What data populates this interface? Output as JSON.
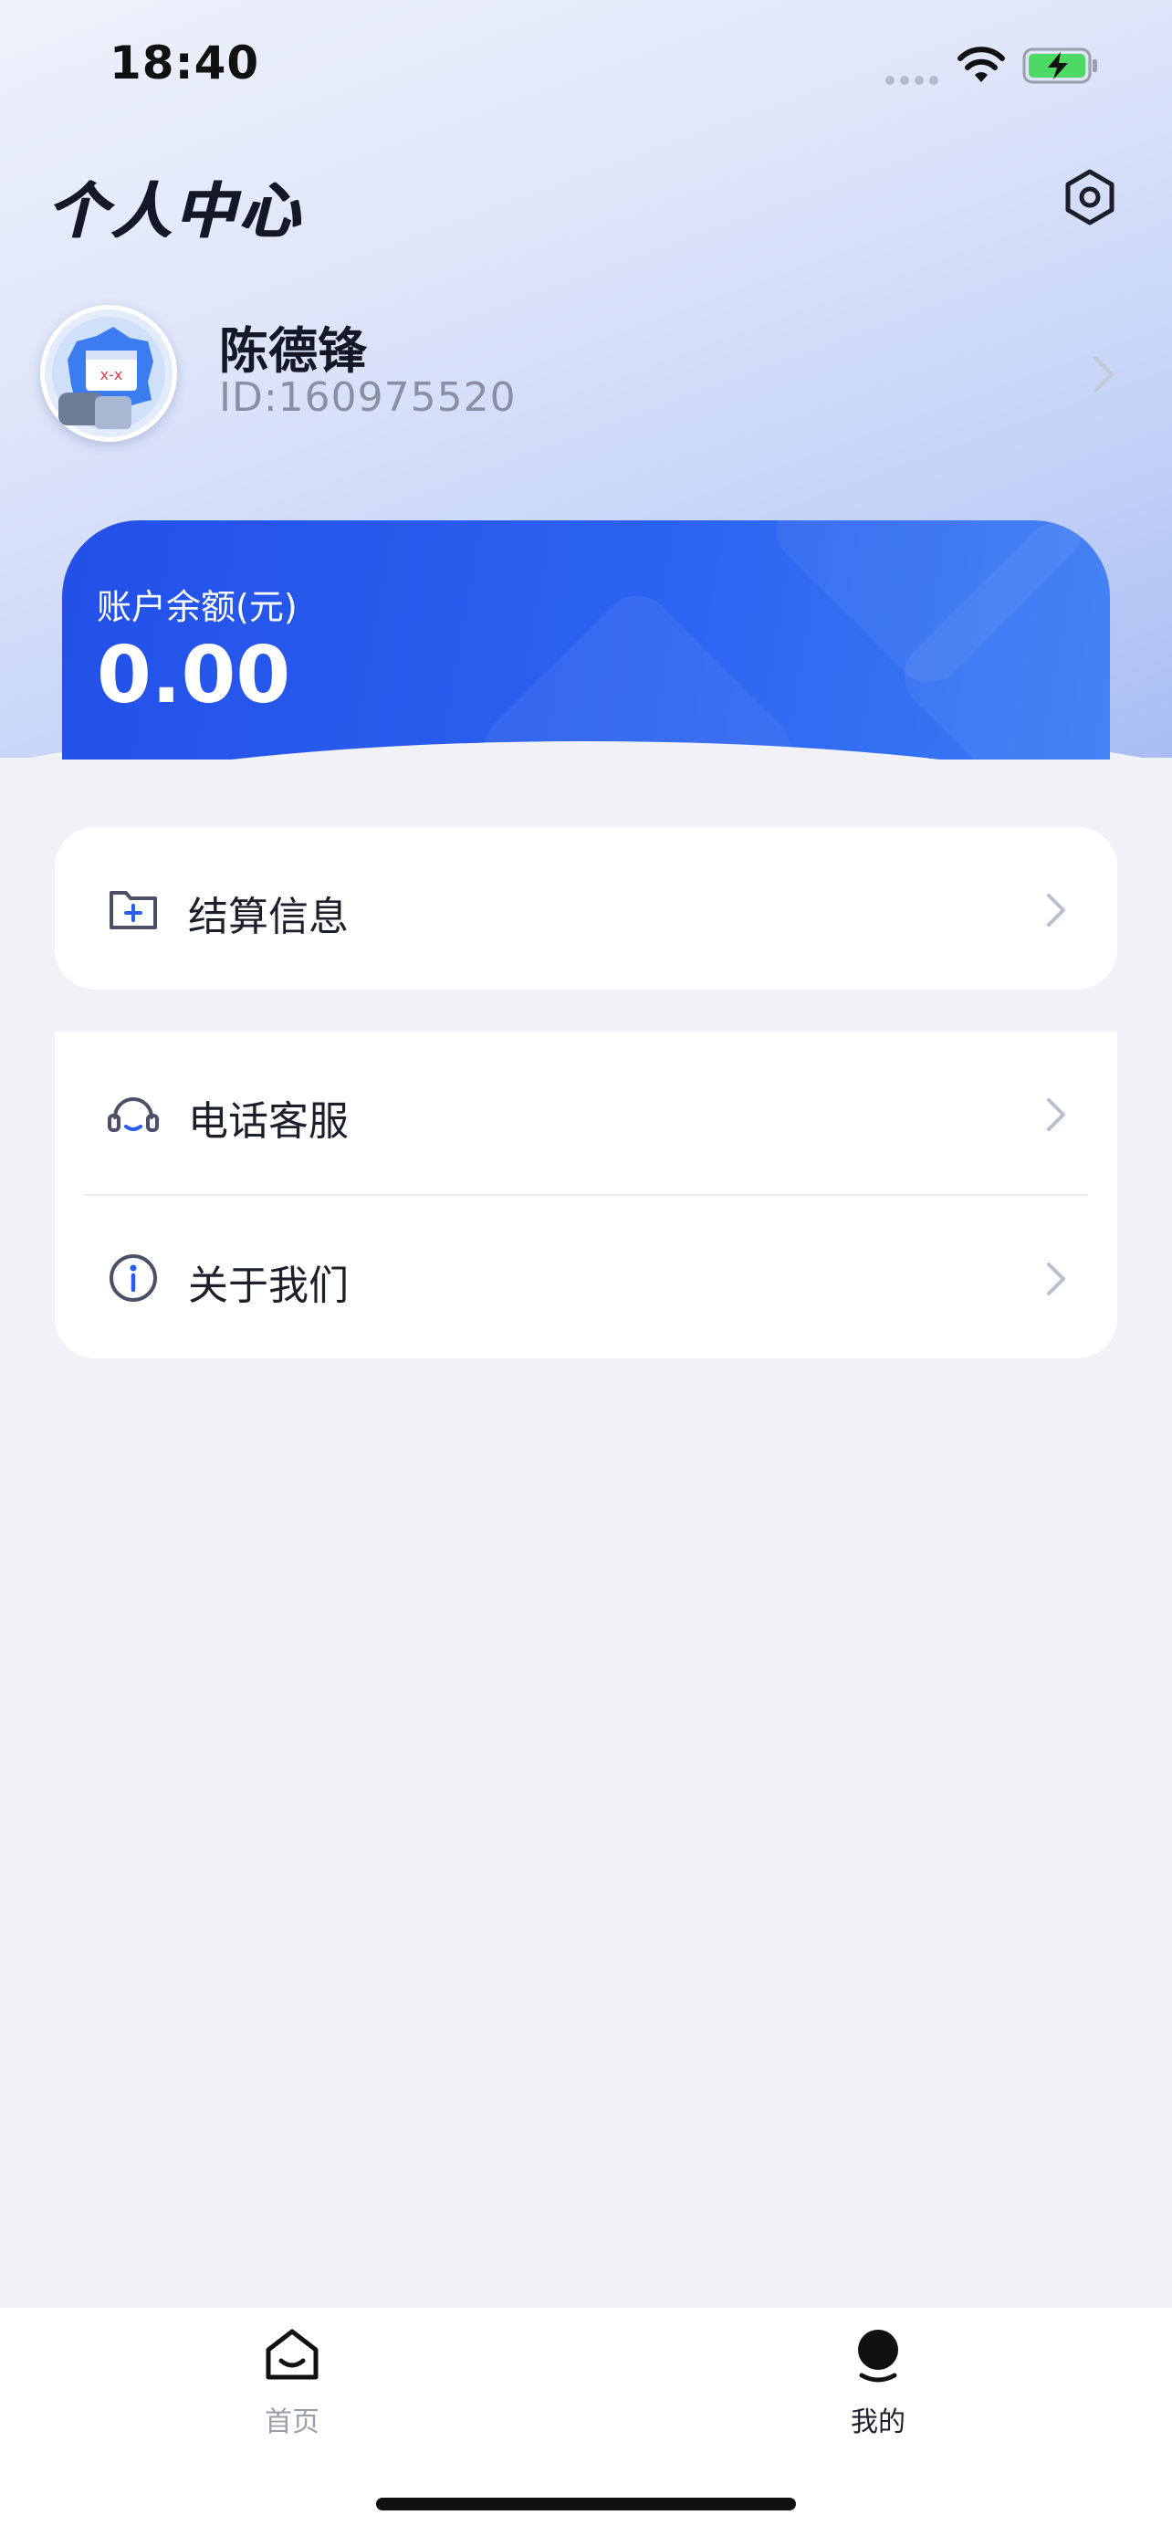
{
  "status_bar": {
    "time": "18:40"
  },
  "header": {
    "title": "个人中心",
    "settings_icon": "settings-hexagon-icon"
  },
  "profile": {
    "name": "陈德锋",
    "id_text": "ID:160975520"
  },
  "balance": {
    "label": "账户余额(元)",
    "value": "0.00"
  },
  "menu": {
    "settlement": {
      "label": "结算信息",
      "icon": "folder-plus-icon"
    },
    "phone_service": {
      "label": "电话客服",
      "icon": "headset-icon"
    },
    "about": {
      "label": "关于我们",
      "icon": "info-icon"
    }
  },
  "tab_bar": {
    "home_label": "首页",
    "mine_label": "我的"
  },
  "colors": {
    "accent": "#2b5cee",
    "background": "#f0f2f7"
  }
}
